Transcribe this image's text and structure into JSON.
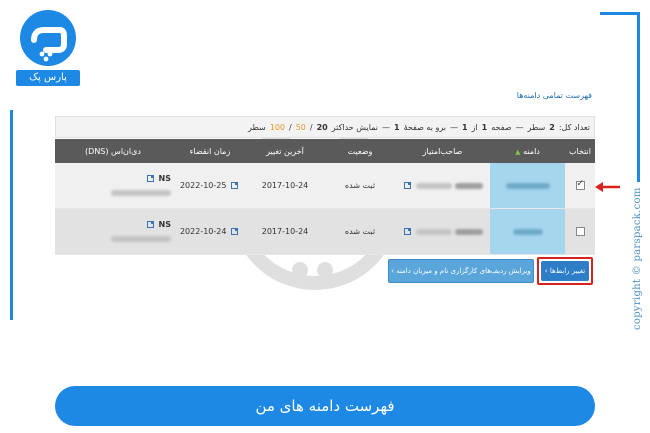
{
  "brand": {
    "logo_text": "پارس پک",
    "copyright": "copyright © parspack.com"
  },
  "page": {
    "title": "فهرست تمامی دامنه‌ها"
  },
  "pager": {
    "total_label": "تعداد کل:",
    "total_value": "2",
    "total_unit": "سطر",
    "page_label": "صفحه",
    "page_current": "1",
    "page_of": "از",
    "page_total": "1",
    "goto_label": "برو به صفحهٔ",
    "goto_value": "1",
    "show_label": "نمایش حداکثر",
    "sizes": [
      "20",
      "50",
      "100"
    ],
    "rows_unit": "سطر"
  },
  "table": {
    "columns": [
      "انتخاب",
      "دامنه",
      "صاحب‌امتیاز",
      "وضعیت",
      "آخرین تغییر",
      "زمان انقضاء",
      "دی‌ان‌اس (DNS)"
    ],
    "rows": [
      {
        "selected": true,
        "status": "ثبت شده",
        "changed": "2017-10-24",
        "expires": "2022-10-25",
        "ns": "NS"
      },
      {
        "selected": false,
        "status": "ثبت شده",
        "changed": "2017-10-24",
        "expires": "2022-10-24",
        "ns": "NS"
      }
    ]
  },
  "buttons": {
    "change_links": "تغییر رابط‌ها ›",
    "edit_contacts": "ویرایش ردیف‌های کارگزاری نام و میزبان دامنه ›"
  },
  "banner": {
    "text": "فهرست دامنه های من"
  },
  "colors": {
    "accent": "#1e88e5",
    "highlight": "#d9221c",
    "header": "#5a5a5a",
    "domain_cell": "#a6d6ee"
  },
  "icons": {
    "external_link": "external-link-icon",
    "sort": "sort-up-icon",
    "arrow": "arrow-left-icon"
  }
}
